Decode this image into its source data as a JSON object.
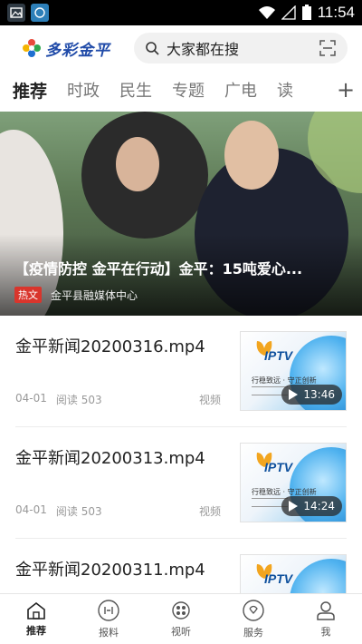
{
  "status_bar": {
    "time": "11:54"
  },
  "header": {
    "logo_text": "多彩金平",
    "search_placeholder": "大家都在搜"
  },
  "tabs": [
    "推荐",
    "时政",
    "民生",
    "专题",
    "广电",
    "读"
  ],
  "tab_add_label": "+",
  "hero": {
    "title": "【疫情防控 金平在行动】金平：15吨爱心...",
    "badge": "热文",
    "source": "金平县融媒体中心"
  },
  "news": [
    {
      "title": "金平新闻20200316.mp4",
      "date": "04-01",
      "reads": "阅读 503",
      "type": "视频",
      "duration": "13:46"
    },
    {
      "title": "金平新闻20200313.mp4",
      "date": "04-01",
      "reads": "阅读 503",
      "type": "视频",
      "duration": "14:24"
    },
    {
      "title": "金平新闻20200311.mp4",
      "date": "",
      "reads": "",
      "type": "",
      "duration": ""
    }
  ],
  "thumbnail": {
    "brand": "IPTV",
    "slogan": "行稳致远 · 守正创新"
  },
  "bottom_nav": [
    {
      "label": "推荐",
      "icon": "home-icon"
    },
    {
      "label": "报料",
      "icon": "camera-icon"
    },
    {
      "label": "视听",
      "icon": "film-icon"
    },
    {
      "label": "服务",
      "icon": "service-icon"
    },
    {
      "label": "我",
      "icon": "user-icon"
    }
  ],
  "colors": {
    "accent": "#d9352c",
    "logo_blue": "#1f4aa8",
    "thumb_blue": "#3b9be0"
  }
}
